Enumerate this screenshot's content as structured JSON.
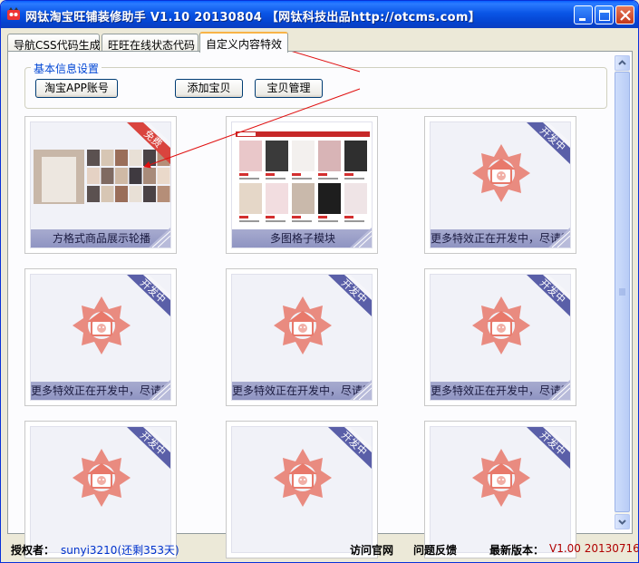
{
  "window": {
    "title": "网钛淘宝旺铺装修助手 V1.10 20130804 【网钛科技出品http://otcms.com】"
  },
  "tabs": [
    {
      "label": "导航CSS代码生成"
    },
    {
      "label": "旺旺在线状态代码"
    },
    {
      "label": "自定义内容特效"
    }
  ],
  "basic_settings": {
    "legend": "基本信息设置",
    "buttons": {
      "taobao_app_account": "淘宝APP账号",
      "add_item": "添加宝贝",
      "item_management": "宝贝管理"
    }
  },
  "cards": [
    {
      "caption": "方格式商品展示轮播",
      "badge": "免费"
    },
    {
      "caption": "多图格子模块",
      "badge": ""
    },
    {
      "caption": "更多特效正在开发中，尽请期待~",
      "badge": "开发中"
    },
    {
      "caption": "更多特效正在开发中，尽请期待~",
      "badge": "开发中"
    },
    {
      "caption": "更多特效正在开发中，尽请期待~",
      "badge": "开发中"
    },
    {
      "caption": "更多特效正在开发中，尽请期待~",
      "badge": "开发中"
    },
    {
      "caption": "",
      "badge": "开发中"
    },
    {
      "caption": "",
      "badge": "开发中"
    },
    {
      "caption": "",
      "badge": "开发中"
    }
  ],
  "status": {
    "license_label": "授权者：",
    "license_value": "sunyi3210(还剩353天)",
    "visit_site": "访问官网",
    "feedback": "问题反馈",
    "latest_label": "最新版本：",
    "latest_value": "V1.00 20130716"
  },
  "colors": {
    "title_bar": "#0A55E6",
    "ribbon_free": "#D9443E",
    "ribbon_dev": "#5A5FA8",
    "caption_bg": "#9CA0CB",
    "gear": "#E8796B"
  }
}
